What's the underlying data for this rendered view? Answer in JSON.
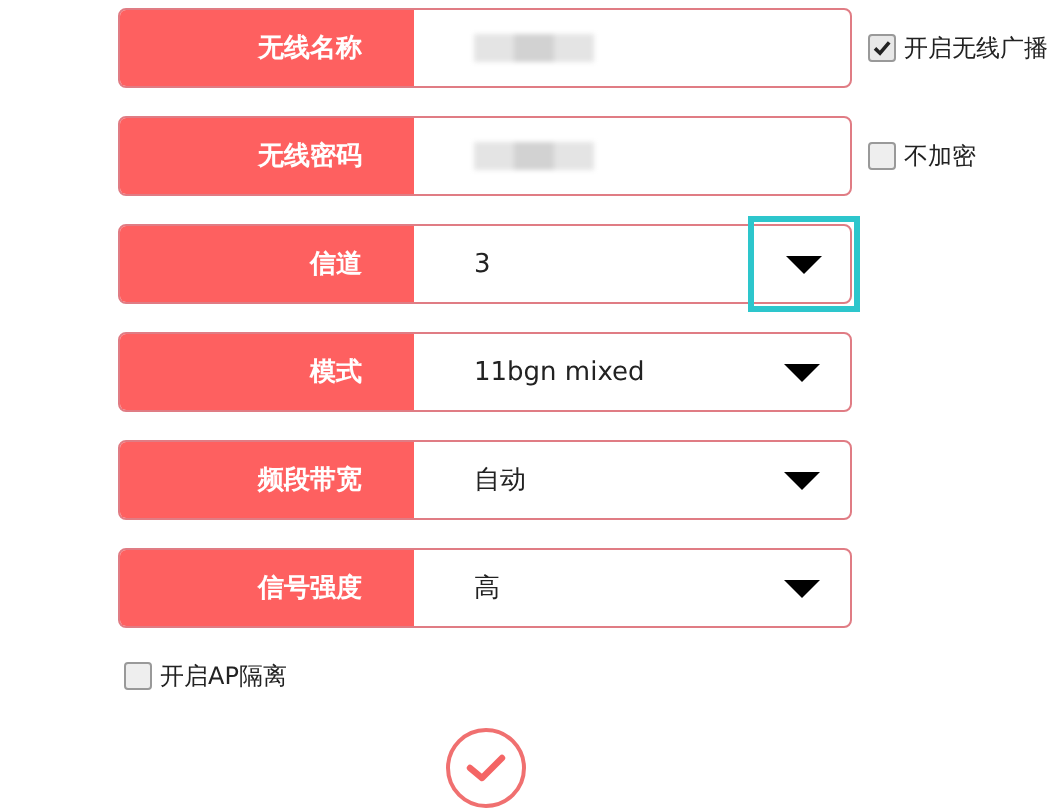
{
  "rows": [
    {
      "label": "无线名称",
      "kind": "text",
      "side_option": {
        "label": "开启无线广播",
        "checked": true
      }
    },
    {
      "label": "无线密码",
      "kind": "text",
      "side_option": {
        "label": "不加密",
        "checked": false
      }
    },
    {
      "label": "信道",
      "kind": "select",
      "value": "3",
      "highlighted": true
    },
    {
      "label": "模式",
      "kind": "select",
      "value": "11bgn mixed",
      "highlighted": false
    },
    {
      "label": "频段带宽",
      "kind": "select",
      "value": "自动",
      "highlighted": false
    },
    {
      "label": "信号强度",
      "kind": "select",
      "value": "高",
      "highlighted": false
    }
  ],
  "ap_isolation": {
    "label": "开启AP隔离",
    "checked": false
  }
}
